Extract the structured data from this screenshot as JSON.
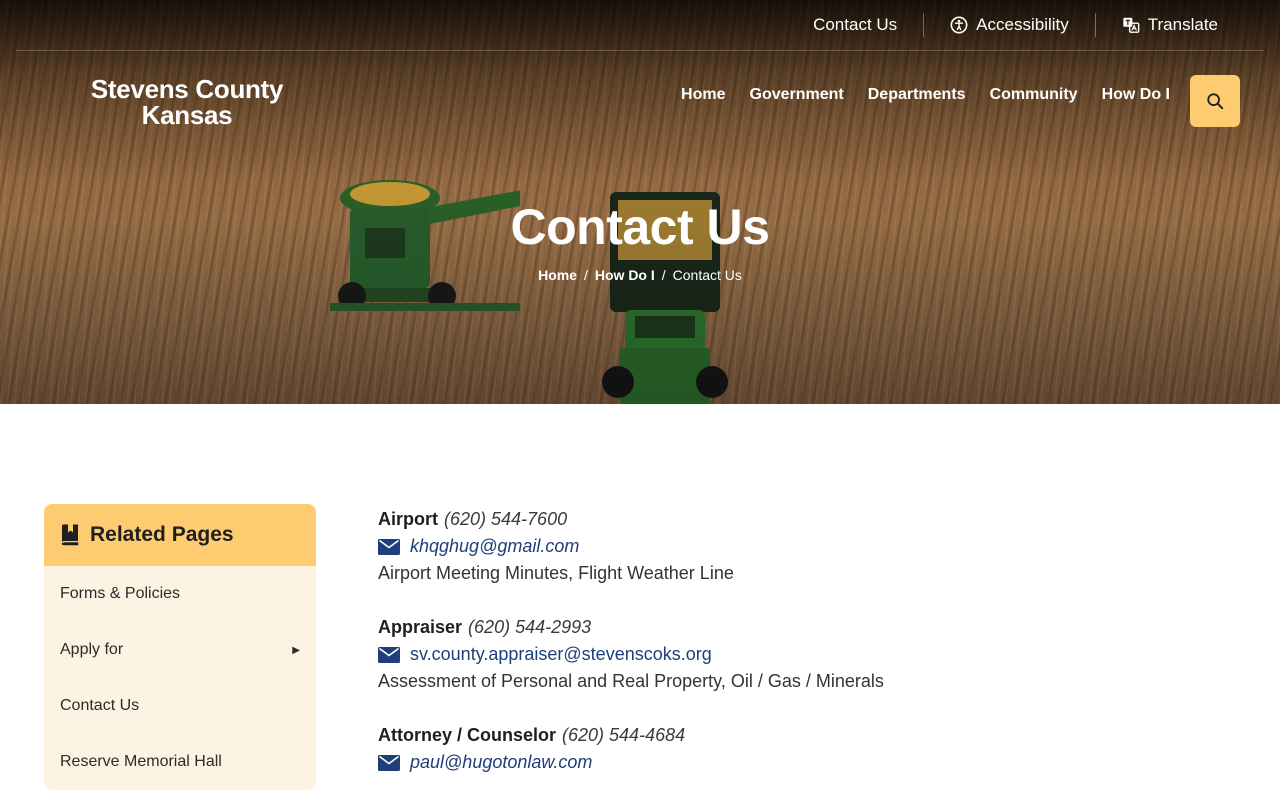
{
  "utility": {
    "contact": "Contact Us",
    "accessibility": "Accessibility",
    "translate": "Translate"
  },
  "brand": {
    "line1": "Stevens County",
    "line2": "Kansas"
  },
  "nav": {
    "items": [
      "Home",
      "Government",
      "Departments",
      "Community",
      "How Do I"
    ]
  },
  "icons": {
    "search": "search-icon",
    "accessibility": "accessibility-icon",
    "translate": "translate-icon",
    "book": "book-icon",
    "mail": "mail-icon"
  },
  "hero": {
    "title": "Contact Us"
  },
  "breadcrumb": {
    "home": "Home",
    "how": "How Do I",
    "current": "Contact Us",
    "separator": "/"
  },
  "sidebar": {
    "title": "Related Pages",
    "items": [
      {
        "label": "Forms & Policies"
      },
      {
        "label": "Apply for"
      },
      {
        "label": "Contact Us"
      },
      {
        "label": "Reserve Memorial Hall"
      }
    ]
  },
  "contacts": [
    {
      "dept": "Airport",
      "phone": "(620) 544-7600",
      "email": "khqghug@gmail.com",
      "desc": "Airport Meeting Minutes, Flight Weather Line"
    },
    {
      "dept": "Appraiser",
      "phone": "(620) 544-2993",
      "email": "sv.county.appraiser@stevenscoks.org",
      "desc": "Assessment of Personal and Real Property, Oil / Gas / Minerals"
    },
    {
      "dept": "Attorney / Counselor",
      "phone": "(620) 544-4684",
      "email": "paul@hugotonlaw.com"
    }
  ],
  "colors": {
    "accent": "#fdcb70",
    "sidebar_bg": "#fdf3e3",
    "link": "#1f3f7a"
  }
}
